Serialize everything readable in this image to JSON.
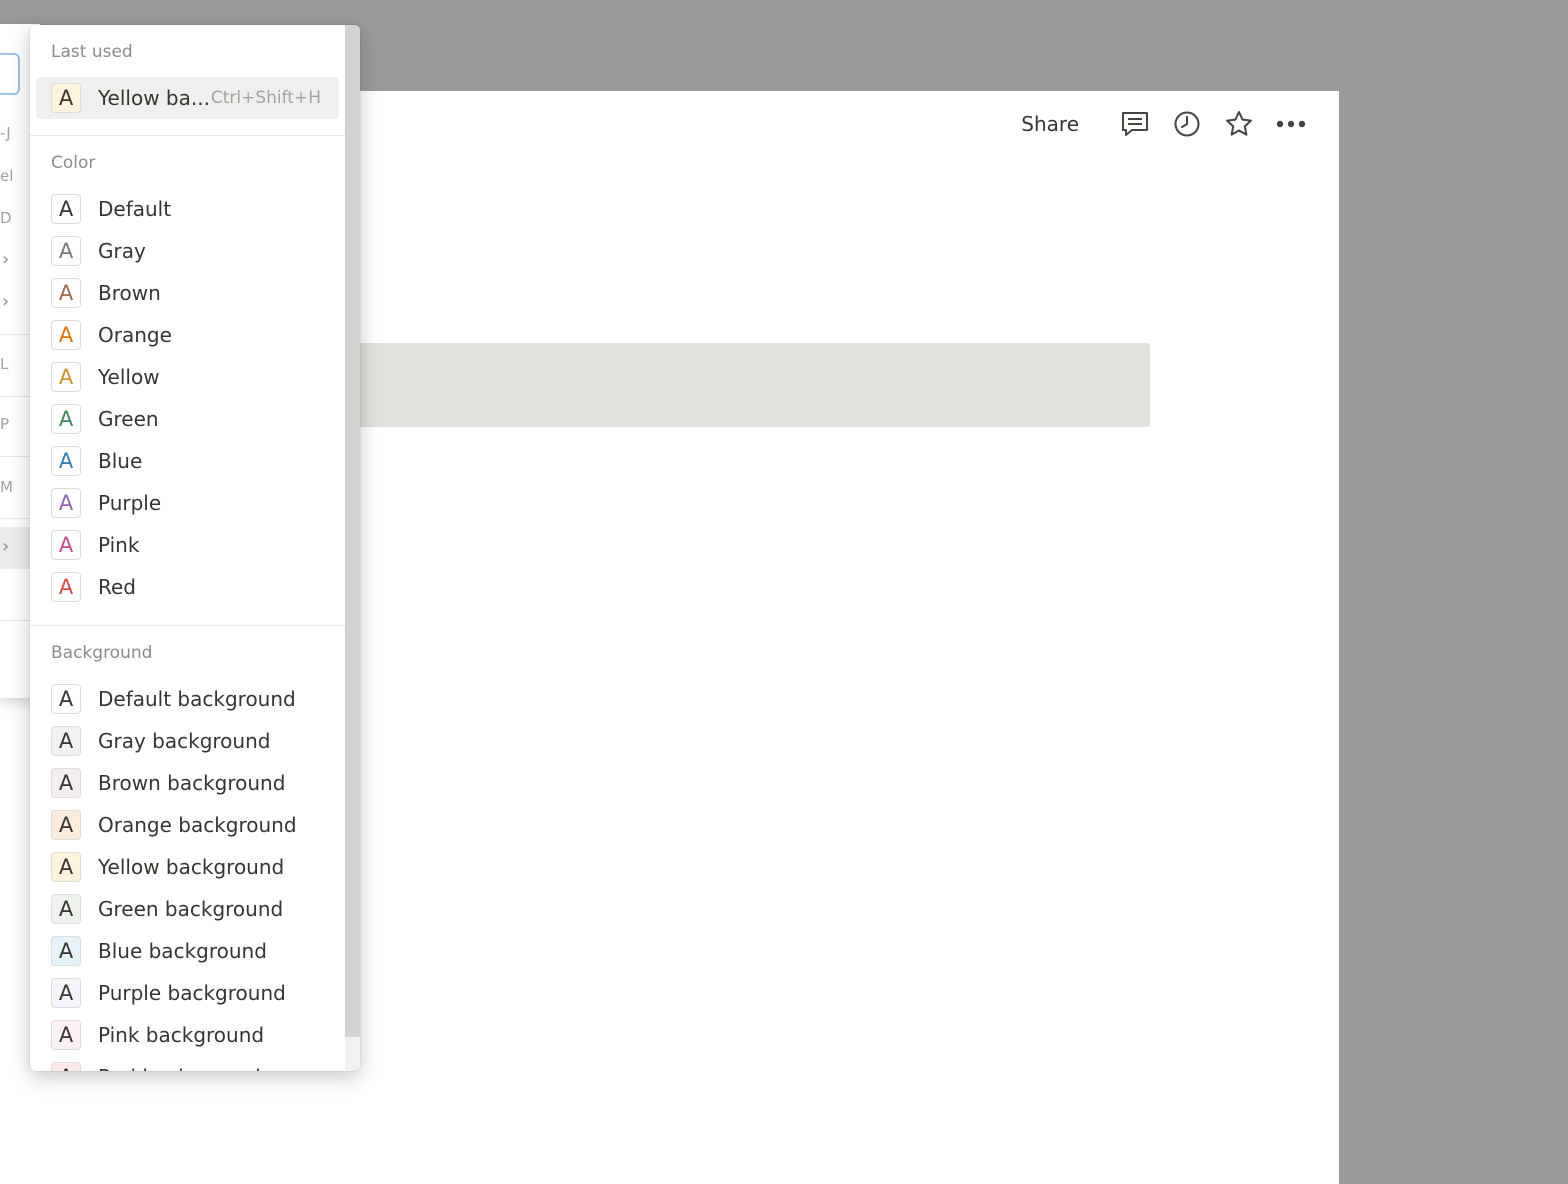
{
  "topbar": {
    "share_label": "Share",
    "icons": [
      "comment-icon",
      "clock-icon",
      "star-icon",
      "more-icon"
    ]
  },
  "left_menu": {
    "fragments": [
      "-J",
      "el",
      "D",
      "L",
      "P",
      "M"
    ]
  },
  "dropdown": {
    "last_used_title": "Last used",
    "last_used_item": {
      "label": "Yellow ba...",
      "shortcut": "Ctrl+Shift+H",
      "bg": "#fbf3db",
      "fg": "#37352f"
    },
    "color_title": "Color",
    "colors": [
      {
        "label": "Default",
        "fg": "#37352f",
        "bg": "#ffffff"
      },
      {
        "label": "Gray",
        "fg": "#787774",
        "bg": "#ffffff"
      },
      {
        "label": "Brown",
        "fg": "#9f6b53",
        "bg": "#ffffff"
      },
      {
        "label": "Orange",
        "fg": "#d9730d",
        "bg": "#ffffff"
      },
      {
        "label": "Yellow",
        "fg": "#cb912f",
        "bg": "#ffffff"
      },
      {
        "label": "Green",
        "fg": "#448361",
        "bg": "#ffffff"
      },
      {
        "label": "Blue",
        "fg": "#337ea9",
        "bg": "#ffffff"
      },
      {
        "label": "Purple",
        "fg": "#9065b0",
        "bg": "#ffffff"
      },
      {
        "label": "Pink",
        "fg": "#c14c8a",
        "bg": "#ffffff"
      },
      {
        "label": "Red",
        "fg": "#d44c47",
        "bg": "#ffffff"
      }
    ],
    "background_title": "Background",
    "backgrounds": [
      {
        "label": "Default background",
        "fg": "#37352f",
        "bg": "#ffffff"
      },
      {
        "label": "Gray background",
        "fg": "#37352f",
        "bg": "#f1f1ef"
      },
      {
        "label": "Brown background",
        "fg": "#37352f",
        "bg": "#f4eeee"
      },
      {
        "label": "Orange background",
        "fg": "#37352f",
        "bg": "#fbecdd"
      },
      {
        "label": "Yellow background",
        "fg": "#37352f",
        "bg": "#fbf3db"
      },
      {
        "label": "Green background",
        "fg": "#37352f",
        "bg": "#edf3ec"
      },
      {
        "label": "Blue background",
        "fg": "#37352f",
        "bg": "#e7f3f8"
      },
      {
        "label": "Purple background",
        "fg": "#37352f",
        "bg": "#f6f3f9"
      },
      {
        "label": "Pink background",
        "fg": "#37352f",
        "bg": "#faf1f5"
      },
      {
        "label": "Red background",
        "fg": "#37352f",
        "bg": "#fdebec"
      }
    ],
    "swatch_glyph": "A"
  }
}
